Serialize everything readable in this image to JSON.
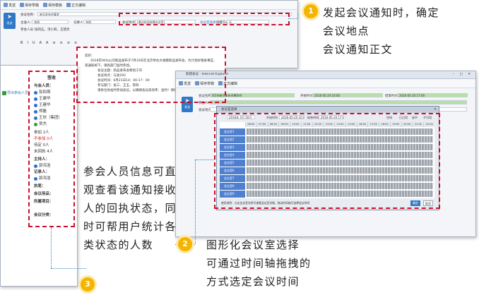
{
  "compose": {
    "toolbar": [
      "发送",
      "保存草稿",
      "保存模板",
      "正文编辑"
    ],
    "send_label": "发送",
    "subject_label": "会议名称：",
    "subject_value": "新品发布会事宜",
    "recipients_label": "主送人：",
    "recipients_value": "张四",
    "cc_label": "记要人：",
    "cc_value": "张四",
    "attendees_label": "参会人员：",
    "attendees_value": "张四五，汤小莉，王建亮",
    "location_label": "会议地点：",
    "location_value": "(通过时间选择会议室)",
    "location_button": "会议室选择",
    "reminder_label": "提醒方式：",
    "reminder_value": "无",
    "format_toolbar": [
      "B",
      "I",
      "U",
      "A",
      "A",
      "≡",
      "≡",
      "≡",
      "≡"
    ],
    "body": {
      "greeting": "您好：",
      "paragraph": "2016年Alifa公司新品发布于7月10日在北京举办大规模新品发布会，为计划好相关事宜，现通知如下，请各部门准时参加。",
      "lines": [
        "会议主题：新品发布会筹划工作",
        "会议地点：与会202",
        "会议时间：6月21日14：00-17：00",
        "参与部门：张三、王五、李四",
        "请各位你准时参加会议，以确保会议高效率、准时！谢谢配合！"
      ]
    }
  },
  "sidebar": {
    "header": "签收",
    "link": "导出参会人员",
    "sections": [
      {
        "title": "与会人员：",
        "names": [
          "张四燕",
          "王建华",
          "王建华",
          "郑磊",
          "王欣（集团）",
          "吴杰"
        ]
      },
      {
        "title": "参加 2人",
        "tone": "normal"
      },
      {
        "title": "不参加 0人",
        "tone": "red"
      },
      {
        "title": "待定 0人",
        "tone": "normal"
      },
      {
        "title": "未回执 4人",
        "tone": "normal"
      },
      {
        "title": "主持人：",
        "names": [
          "郭鸿浩"
        ]
      },
      {
        "title": "记录人：",
        "names": [
          "郭鸿浩"
        ]
      },
      {
        "title": "执笔：",
        "names": []
      },
      {
        "title": "会议用品：",
        "names": []
      },
      {
        "title": "所属项目：",
        "names": []
      },
      {
        "title": "会议分类：",
        "names": []
      }
    ]
  },
  "scheduler": {
    "window_title": "新建会议 - Internet Explorer",
    "toolbar": [
      "发送",
      "保存草稿",
      "正文编辑"
    ],
    "send_label": "发送",
    "subject_label": "会议名称：",
    "subject_value": "X月份新品发布会筹划会",
    "start_label": "开始时间：",
    "start_value": "2016-05-20 16:00",
    "end_label": "结束时间：",
    "end_value": "2016-05-20 17:00",
    "attendees_label": "参会人：",
    "location_label": "会议地点：",
    "dialog_title": "会议室选择",
    "date_value": "2016年 5月 20日",
    "start_pick_label": "开始时间",
    "start_pick_value": "2016-05-20 16:00",
    "end_pick_label": "结束时间",
    "end_pick_value": "2016-05-20 17:00",
    "legend": [
      "空闲",
      "已占用",
      "选中",
      "不可用"
    ],
    "hours": [
      "06:00",
      "07:00",
      "08:00",
      "09:00",
      "10:00",
      "11:00",
      "12:00",
      "13:00",
      "14:00",
      "15:00",
      "16:00",
      "17:00",
      "18:00",
      "19:00",
      "20:00",
      "21:00",
      "22:00"
    ],
    "rooms": [
      "会议室1",
      "会议室2",
      "会议室3",
      "会议室4",
      "会议室5",
      "会议室6",
      "会议室7",
      "会议室8",
      "会议室9"
    ],
    "footer_text": "使用说明：点击会议室名称可查看会议室详情，拖动时间轴可选择会议时间",
    "ok_label": "确定",
    "cancel_label": "取消"
  },
  "annotations": {
    "a1_number": "1",
    "a1_lines": [
      "发起会议通知时，确定",
      "会议地点",
      "会议通知正文"
    ],
    "a2_number": "2",
    "a2_lines": [
      "图形化会议室选择",
      "可通过时间轴拖拽的",
      "方式选定会议时间"
    ],
    "a3_number": "3",
    "a3_lines": [
      "参会人员信息可直",
      "观查看该通知接收",
      "人的回执状态，同",
      "时可帮用户统计各",
      "类状态的人数"
    ]
  },
  "colors": {
    "accent_red": "#c8102e",
    "badge_yellow": "#f4b400",
    "send_blue": "#2f79c6",
    "guide_blue": "#2e86c1"
  }
}
